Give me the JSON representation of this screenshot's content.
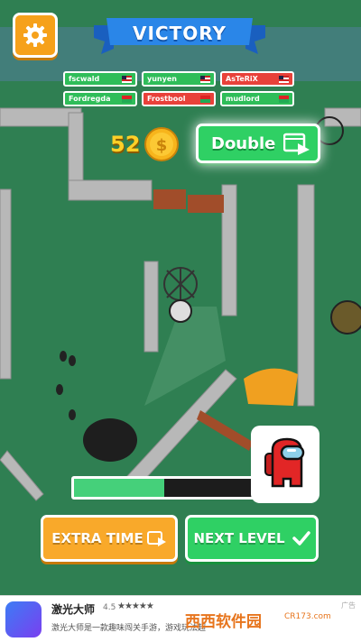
{
  "header": {
    "title": "VICTORY"
  },
  "icons": {
    "settings": "gear-icon",
    "coin": "coin-icon",
    "video": "video-icon",
    "check": "checkmark-icon",
    "avatar": "crewmate-icon"
  },
  "players": [
    {
      "name": "fscwald",
      "status": "green",
      "flag": "flag-icon"
    },
    {
      "name": "yunyen",
      "status": "green",
      "flag": "flag-icon"
    },
    {
      "name": "AsTeRiX",
      "status": "red",
      "flag": "flag-icon"
    },
    {
      "name": "Fordregda",
      "status": "green",
      "flag": "flag-icon"
    },
    {
      "name": "Frostbool",
      "status": "red",
      "flag": "flag-icon"
    },
    {
      "name": "mudlord",
      "status": "green",
      "flag": "flag-icon"
    }
  ],
  "coins": {
    "count": "52"
  },
  "double_button": {
    "label": "Double"
  },
  "progress": {
    "fraction": 0.49
  },
  "buttons": {
    "extra_time": "EXTRA TIME",
    "next_level": "NEXT LEVEL"
  },
  "ad": {
    "title": "激光大师",
    "rating": "4.5",
    "stars": "★★★★★",
    "desc": "激光大师是一款趣味闯关手游，游戏玩法超",
    "tag": "广告",
    "brand": "西西软件园",
    "brand_url": "CR173.com"
  },
  "colors": {
    "green": "#2fd064",
    "orange": "#f9a92a",
    "red": "#e8413a",
    "floor": "#2e7d4f"
  }
}
